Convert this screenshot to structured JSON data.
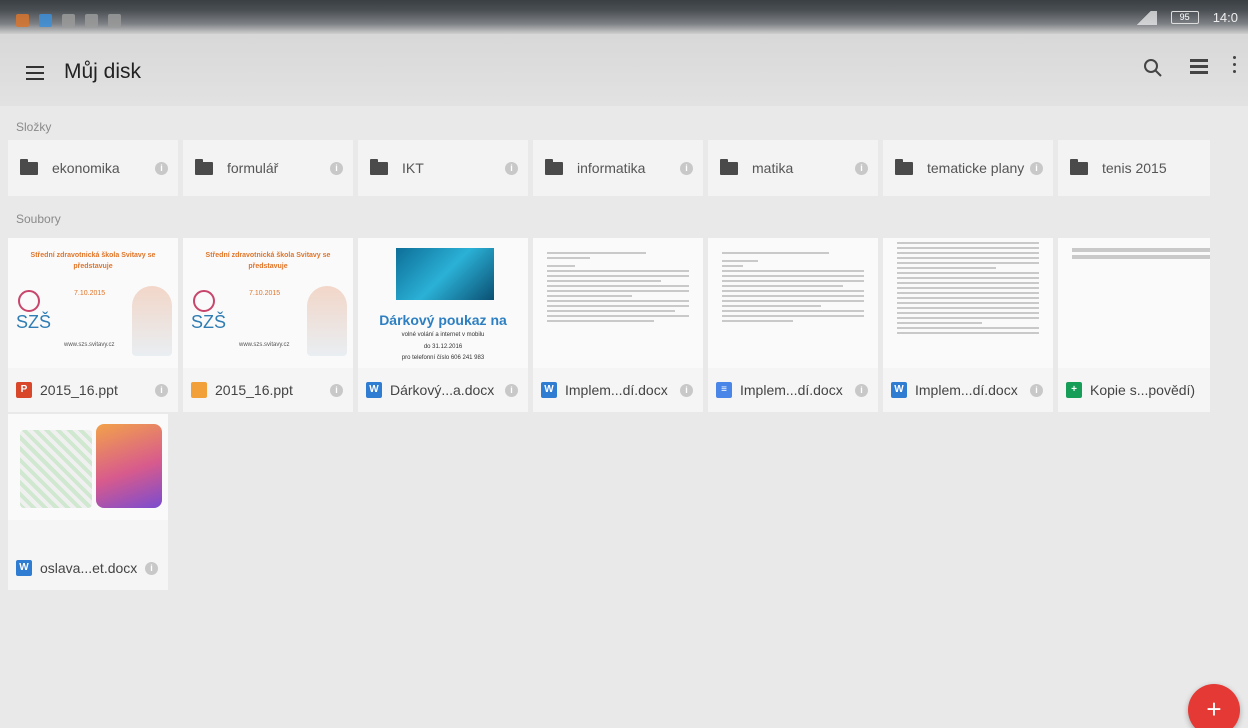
{
  "status_bar": {
    "time": "14:0",
    "battery": "95"
  },
  "header": {
    "title": "Můj disk"
  },
  "sections": {
    "folders": "Složky",
    "files": "Soubory"
  },
  "folders": [
    {
      "name": "ekonomika"
    },
    {
      "name": "formulář"
    },
    {
      "name": "IKT"
    },
    {
      "name": "informatika"
    },
    {
      "name": "matika"
    },
    {
      "name": "tematicke plany"
    },
    {
      "name": "tenis 2015"
    }
  ],
  "files": [
    {
      "name": "2015_16.ppt",
      "type": "P",
      "color": "#d9472b"
    },
    {
      "name": "2015_16.ppt",
      "type": "",
      "color": "#f2a13a"
    },
    {
      "name": "Dárkový...a.docx",
      "type": "W",
      "color": "#2f7cd3"
    },
    {
      "name": "Implem...dí.docx",
      "type": "W",
      "color": "#2f7cd3"
    },
    {
      "name": "Implem...dí.docx",
      "type": "≡",
      "color": "#4a86e8"
    },
    {
      "name": "Implem...dí.docx",
      "type": "W",
      "color": "#2f7cd3"
    },
    {
      "name": "Kopie s...povědí)",
      "type": "+",
      "color": "#169d58"
    },
    {
      "name": "oslava...et.docx",
      "type": "W",
      "color": "#2f7cd3"
    }
  ],
  "thumbs": {
    "ppt_title": "Střední zdravotnická škola Svitavy se představuje",
    "ppt_date": "7.10.2015",
    "ppt_logo": "SZŠ",
    "ppt_web": "www.szs.svitavy.cz",
    "voucher_title": "Dárkový poukaz na",
    "voucher_line1": "volné volání a internet v mobilu",
    "voucher_line2": "do 31.12.2016",
    "voucher_line3": "pro telefonní číslo 606 241 983"
  },
  "fab": {
    "label": "+"
  }
}
